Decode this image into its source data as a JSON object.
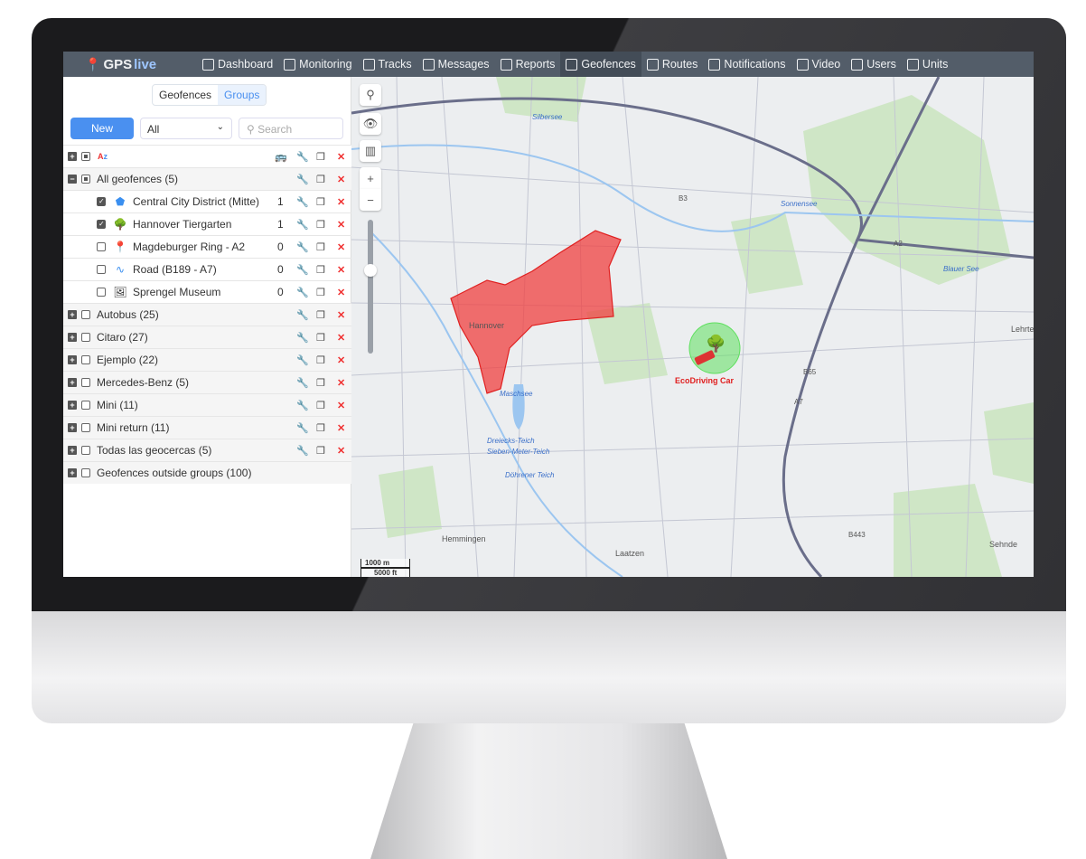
{
  "nav": {
    "logo": {
      "part1": "GPS",
      "part2": "live"
    },
    "items": [
      {
        "label": "Dashboard",
        "icon": "bar-chart-icon"
      },
      {
        "label": "Monitoring",
        "icon": "globe-icon"
      },
      {
        "label": "Tracks",
        "icon": "flag-icon"
      },
      {
        "label": "Messages",
        "icon": "message-list-icon"
      },
      {
        "label": "Reports",
        "icon": "report-icon"
      },
      {
        "label": "Geofences",
        "icon": "polygon-icon",
        "active": true
      },
      {
        "label": "Routes",
        "icon": "map-pin-icon"
      },
      {
        "label": "Notifications",
        "icon": "alarm-icon"
      },
      {
        "label": "Video",
        "icon": "video-icon"
      },
      {
        "label": "Users",
        "icon": "user-icon"
      },
      {
        "label": "Units",
        "icon": "bus-icon"
      }
    ]
  },
  "panel": {
    "tabs": [
      "Geofences",
      "Groups"
    ],
    "active_tab": "Groups",
    "new_label": "New",
    "filter_value": "All",
    "search_placeholder": "Search",
    "all_group": {
      "label": "All geofences (5)",
      "children": [
        {
          "name": "Central City District (Mitte)",
          "count": "1",
          "checked": true,
          "icon": "polygon-icon"
        },
        {
          "name": "Hannover Tiergarten",
          "count": "1",
          "checked": true,
          "icon": "tree-icon"
        },
        {
          "name": "Magdeburger Ring - A2",
          "count": "0",
          "checked": false,
          "icon": "pin-icon"
        },
        {
          "name": "Road (B189 - A7)",
          "count": "0",
          "checked": false,
          "icon": "road-line-icon"
        },
        {
          "name": "Sprengel Museum",
          "count": "0",
          "checked": false,
          "icon": "photo-icon"
        }
      ]
    },
    "groups": [
      "Autobus (25)",
      "Citaro (27)",
      "Ejemplo (22)",
      "Mercedes-Benz (5)",
      "Mini (11)",
      "Mini return (11)",
      "Todas las geocercas (5)"
    ],
    "outside": "Geofences outside groups (100)"
  },
  "map": {
    "labels": {
      "hannover": "Hannover",
      "maschsee": "Maschsee",
      "hemmingen": "Hemmingen",
      "laatzen": "Laatzen",
      "sehnde": "Sehnde",
      "lehrte": "Lehrte",
      "silbersee": "Silbersee",
      "sonnensee": "Sonnensee",
      "blauer": "Blauer See",
      "dreiecks": "Dreiecks-Teich",
      "sieben": "Sieben-Meter-Teich",
      "dohrener": "Döhrener Teich",
      "a2": "A2",
      "a7": "A7",
      "b65": "B65",
      "b443": "B443",
      "b3": "B3"
    },
    "unit_label": "EcoDriving Car",
    "scale_m": "1000 m",
    "scale_ft": "5000 ft",
    "geofence_color": "#f04040",
    "circle_color": "#5ee05e"
  }
}
